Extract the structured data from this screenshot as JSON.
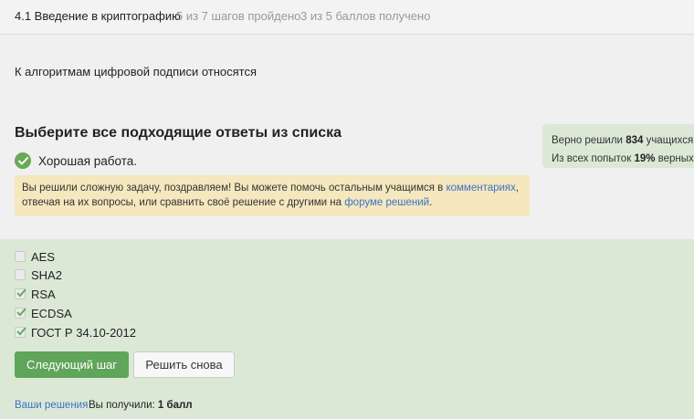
{
  "header": {
    "lesson_title": "4.1 Введение в криптографию",
    "steps_progress": "5 из 7 шагов пройдено",
    "points_progress": "3 из 5 баллов  получено"
  },
  "question": {
    "text": "К алгоритмам цифровой подписи относятся",
    "instruction": "Выберите все подходящие ответы из списка"
  },
  "feedback": {
    "success_text": "Хорошая работа.",
    "notice_part1": "Вы решили сложную задачу, поздравляем! Вы можете помочь остальным учащимся в ",
    "comments_link": "комментариях",
    "notice_part2": ", отвечая на их вопросы, или сравнить своё решение с другими на ",
    "forum_link": "форуме решений",
    "notice_part3": "."
  },
  "stats": {
    "solved_prefix": "Верно решили ",
    "solved_count": "834",
    "solved_suffix": " учащихся",
    "attempts_prefix": "Из всех попыток ",
    "attempts_percent": "19%",
    "attempts_suffix": " верных"
  },
  "options": [
    {
      "label": "AES",
      "checked": false
    },
    {
      "label": "SHA2",
      "checked": false
    },
    {
      "label": "RSA",
      "checked": true
    },
    {
      "label": "ECDSA",
      "checked": true
    },
    {
      "label": "ГОСТ Р 34.10-2012",
      "checked": true
    }
  ],
  "buttons": {
    "next_step": "Следующий шаг",
    "solve_again": "Решить снова"
  },
  "footer": {
    "your_solutions": "Ваши решения",
    "you_got_prefix": "Вы получили: ",
    "you_got_value": "1 балл"
  },
  "colors": {
    "success_green": "#66aa57",
    "button_green": "#5fa55a",
    "answers_bg": "#dbe8d6",
    "notice_bg": "#f5e7be",
    "link_blue": "#3a73c5"
  }
}
